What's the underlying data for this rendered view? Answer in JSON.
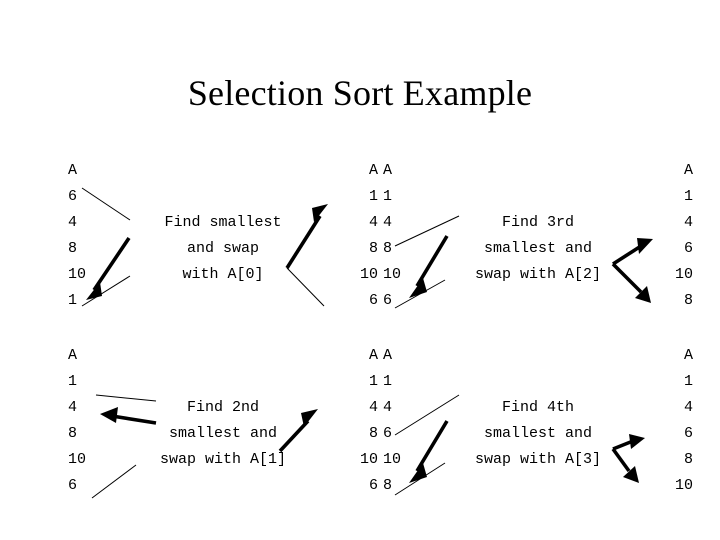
{
  "slide": {
    "title": "Selection Sort Example",
    "background_color": "#ffffff",
    "text_color": "#000000"
  },
  "panels": [
    {
      "id": "step-1",
      "caption_lines": [
        "Find smallest",
        "and swap",
        "with A[0]"
      ],
      "before": {
        "header": "A",
        "values": [
          "6",
          "4",
          "8",
          "10",
          "1"
        ]
      },
      "after": {
        "header": "A",
        "values": [
          "1",
          "4",
          "8",
          "10",
          "6"
        ]
      }
    },
    {
      "id": "step-3",
      "caption_lines": [
        "Find 3rd",
        "smallest and",
        "swap with A[2]"
      ],
      "before": {
        "header": "A",
        "values": [
          "1",
          "4",
          "8",
          "10",
          "6"
        ]
      },
      "after": {
        "header": "A",
        "values": [
          "1",
          "4",
          "6",
          "10",
          "8"
        ]
      }
    },
    {
      "id": "step-2",
      "caption_lines": [
        "Find 2nd",
        "smallest and",
        "swap with A[1]"
      ],
      "before": {
        "header": "A",
        "values": [
          "1",
          "4",
          "8",
          "10",
          "6"
        ]
      },
      "after": {
        "header": "A",
        "values": [
          "1",
          "4",
          "8",
          "10",
          "6"
        ]
      }
    },
    {
      "id": "step-4",
      "caption_lines": [
        "Find 4th",
        "smallest and",
        "swap with A[3]"
      ],
      "before": {
        "header": "A",
        "values": [
          "1",
          "4",
          "6",
          "10",
          "8"
        ]
      },
      "after": {
        "header": "A",
        "values": [
          "1",
          "4",
          "6",
          "8",
          "10"
        ]
      }
    }
  ]
}
